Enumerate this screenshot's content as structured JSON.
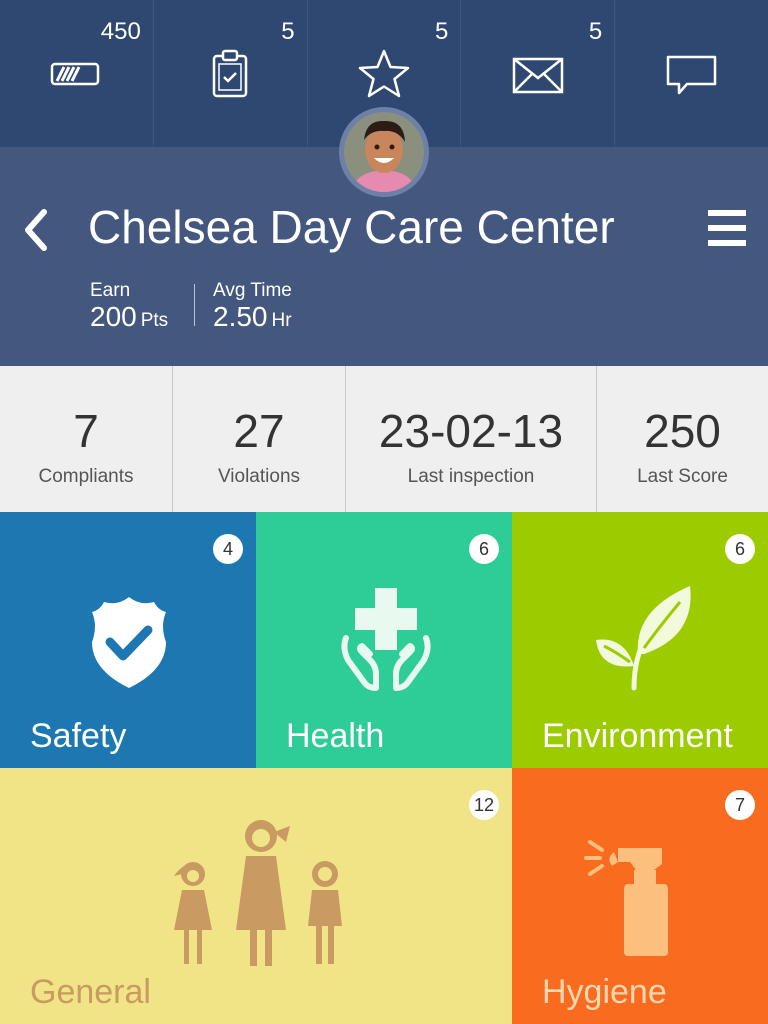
{
  "topbar": {
    "items": [
      {
        "count": "450",
        "icon": "battery-icon"
      },
      {
        "count": "5",
        "icon": "clipboard-check-icon"
      },
      {
        "count": "5",
        "icon": "star-icon"
      },
      {
        "count": "5",
        "icon": "envelope-icon"
      },
      {
        "count": "",
        "icon": "chat-bubble-icon"
      }
    ]
  },
  "header": {
    "title": "Chelsea Day Care Center",
    "earn_label": "Earn",
    "earn_value": "200",
    "earn_unit": "Pts",
    "time_label": "Avg Time",
    "time_value": "2.50",
    "time_unit": "Hr"
  },
  "summary": [
    {
      "value": "7",
      "label": "Compliants"
    },
    {
      "value": "27",
      "label": "Violations"
    },
    {
      "value": "23-02-13",
      "label": "Last inspection"
    },
    {
      "value": "250",
      "label": "Last Score"
    }
  ],
  "tiles": [
    {
      "label": "Safety",
      "badge": "4",
      "color": "#1d78b2",
      "icon": "shield-check-icon"
    },
    {
      "label": "Health",
      "badge": "6",
      "color": "#2ecc96",
      "icon": "medical-cross-hands-icon"
    },
    {
      "label": "Environment",
      "badge": "6",
      "color": "#9ccc00",
      "icon": "leaf-icon"
    },
    {
      "label": "General",
      "badge": "12",
      "color": "#f0e486",
      "icon": "family-icon"
    },
    {
      "label": "Hygiene",
      "badge": "7",
      "color": "#f96c1f",
      "icon": "spray-bottle-icon"
    }
  ]
}
